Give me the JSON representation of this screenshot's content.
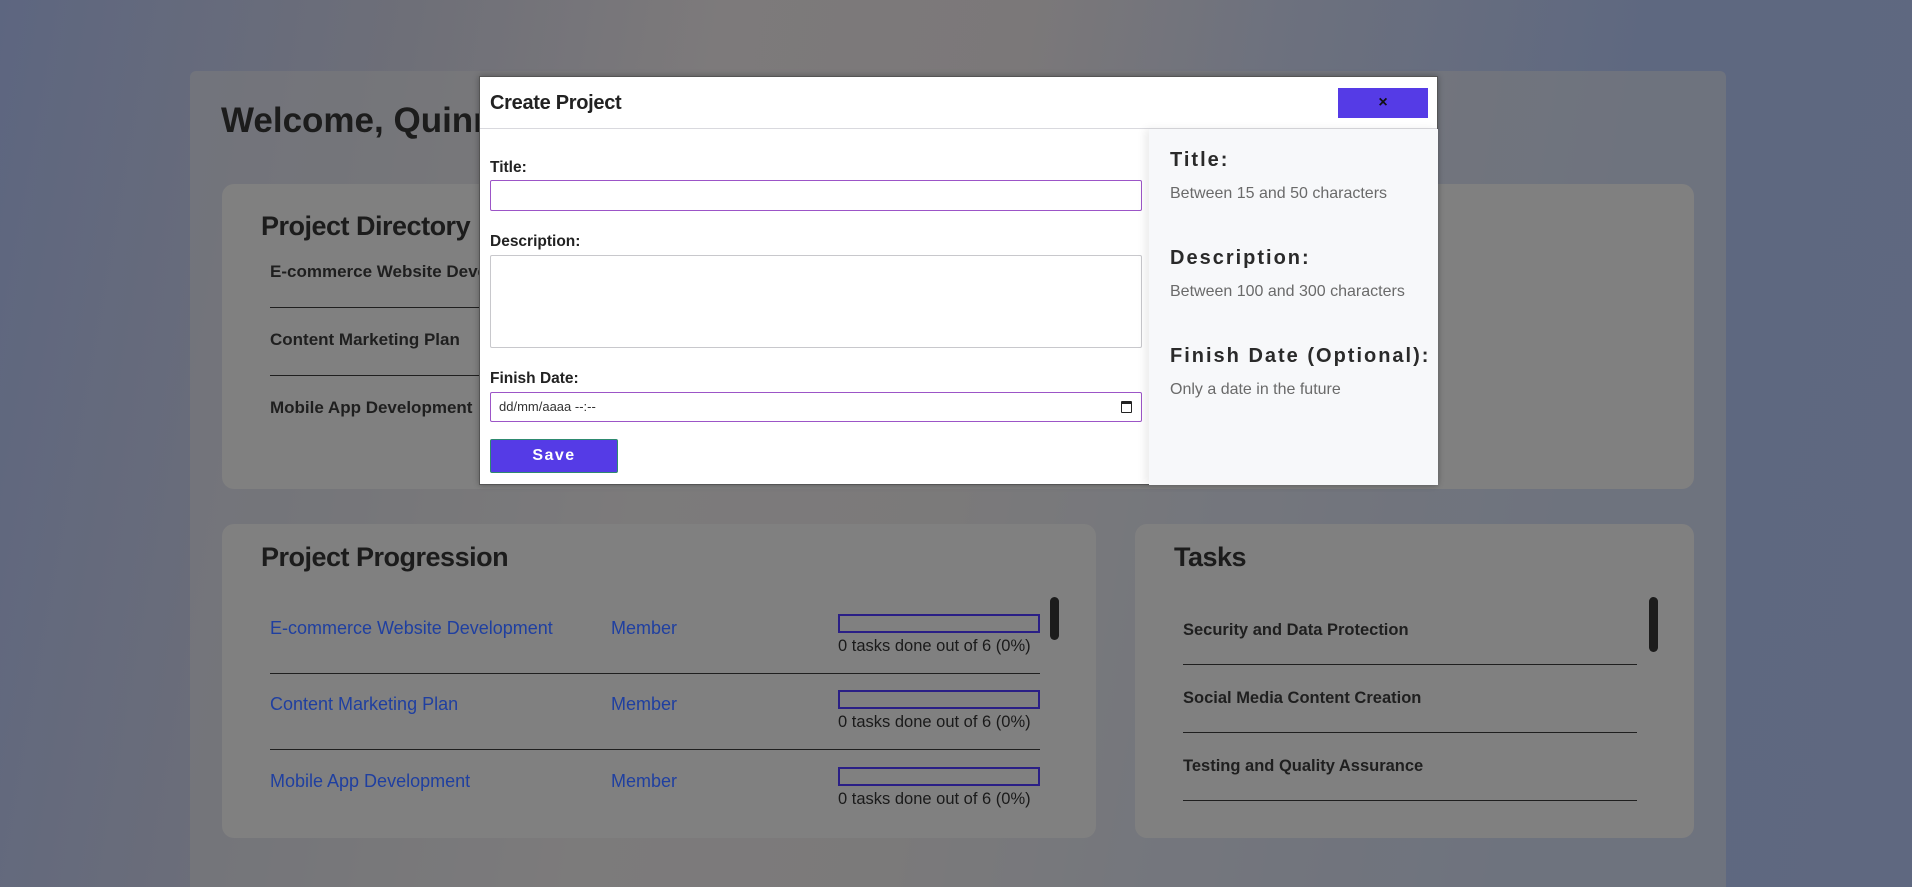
{
  "page": {
    "welcome": "Welcome, Quinn"
  },
  "directory": {
    "title": "Project Directory",
    "items": [
      "E-commerce Website Development",
      "Content Marketing Plan",
      "Mobile App Development"
    ]
  },
  "progression": {
    "title": "Project Progression",
    "rows": [
      {
        "name": "E-commerce Website Development",
        "role": "Member",
        "done": 0,
        "total": 6,
        "percent": 0,
        "text": "0 tasks done out of 6 (0%)"
      },
      {
        "name": "Content Marketing Plan",
        "role": "Member",
        "done": 0,
        "total": 6,
        "percent": 0,
        "text": "0 tasks done out of 6 (0%)"
      },
      {
        "name": "Mobile App Development",
        "role": "Member",
        "done": 0,
        "total": 6,
        "percent": 0,
        "text": "0 tasks done out of 6 (0%)"
      }
    ]
  },
  "tasks": {
    "title": "Tasks",
    "items": [
      "Security and Data Protection",
      "Social Media Content Creation",
      "Testing and Quality Assurance"
    ]
  },
  "modal": {
    "title": "Create Project",
    "close_icon": "×",
    "form": {
      "title_label": "Title:",
      "title_value": "",
      "description_label": "Description:",
      "description_value": "",
      "finish_label": "Finish Date:",
      "finish_placeholder": "dd/mm/aaaa --:--",
      "save_label": "Save"
    },
    "help": {
      "title_head": "Title:",
      "title_text": "Between 15 and 50 characters",
      "description_head": "Description:",
      "description_text": "Between 100 and 300 characters",
      "finish_head": "Finish Date (Optional):",
      "finish_text": "Only a date in the future"
    }
  },
  "colors": {
    "accent": "#553be6",
    "input_focus_border": "#9c55c7",
    "link": "#1f3fa0",
    "progress_border": "#2a1f86"
  }
}
